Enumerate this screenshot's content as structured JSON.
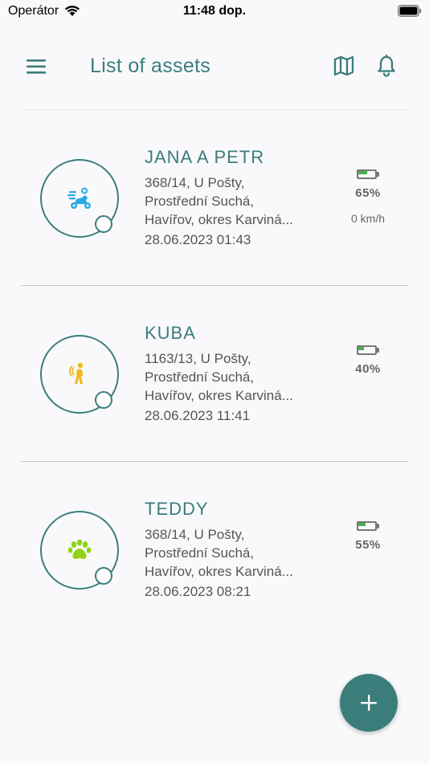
{
  "status_bar": {
    "carrier": "Operátor",
    "time": "11:48 dop."
  },
  "header": {
    "title": "List of assets",
    "icons": [
      "menu-icon",
      "map-icon",
      "bell-icon"
    ]
  },
  "colors": {
    "accent": "#3b7d7b",
    "background": "#f9f9fc",
    "battery_fill": "#4caf50",
    "scooter_icon": "#29a9e0",
    "person_icon": "#f2b81b",
    "paw_icon": "#8fd316"
  },
  "assets": [
    {
      "name": "JANA A PETR",
      "icon": "scooter-icon",
      "address_lines": [
        "368/14, U Pošty,",
        "Prostřední Suchá,",
        "Havířov, okres Karviná..."
      ],
      "timestamp": "28.06.2023 01:43",
      "battery_percent": 65,
      "battery_label": "65%",
      "speed": "0 km/h"
    },
    {
      "name": "KUBA",
      "icon": "walking-person-icon",
      "address_lines": [
        "1163/13, U Pošty,",
        "Prostřední Suchá,",
        "Havířov, okres Karviná..."
      ],
      "timestamp": "28.06.2023 11:41",
      "battery_percent": 40,
      "battery_label": "40%"
    },
    {
      "name": "TEDDY",
      "icon": "paw-icon",
      "address_lines": [
        "368/14, U Pošty,",
        "Prostřední Suchá,",
        "Havířov, okres Karviná..."
      ],
      "timestamp": "28.06.2023 08:21",
      "battery_percent": 55,
      "battery_label": "55%"
    }
  ],
  "fab": {
    "icon": "plus-icon"
  }
}
